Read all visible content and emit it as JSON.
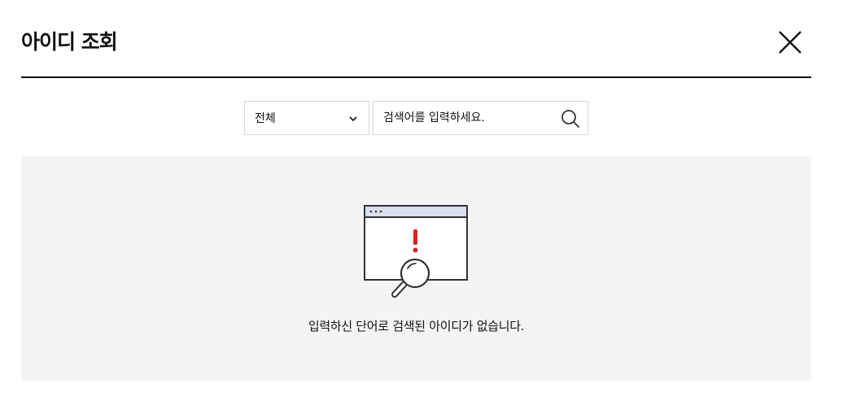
{
  "header": {
    "title": "아이디 조회",
    "close_icon": "close-icon"
  },
  "search": {
    "filter_selected": "전체",
    "filter_icon": "chevron-down-icon",
    "placeholder": "검색어를 입력하세요.",
    "value": "",
    "search_icon": "search-icon"
  },
  "results": {
    "empty_icon": "no-results-browser-icon",
    "empty_message": "입력하신 단어로 검색된 아이디가 없습니다."
  },
  "colors": {
    "alert_red": "#e2211c",
    "browser_bar": "#d9dfeb",
    "panel_bg": "#f4f4f4",
    "border": "#d7d7d7"
  }
}
